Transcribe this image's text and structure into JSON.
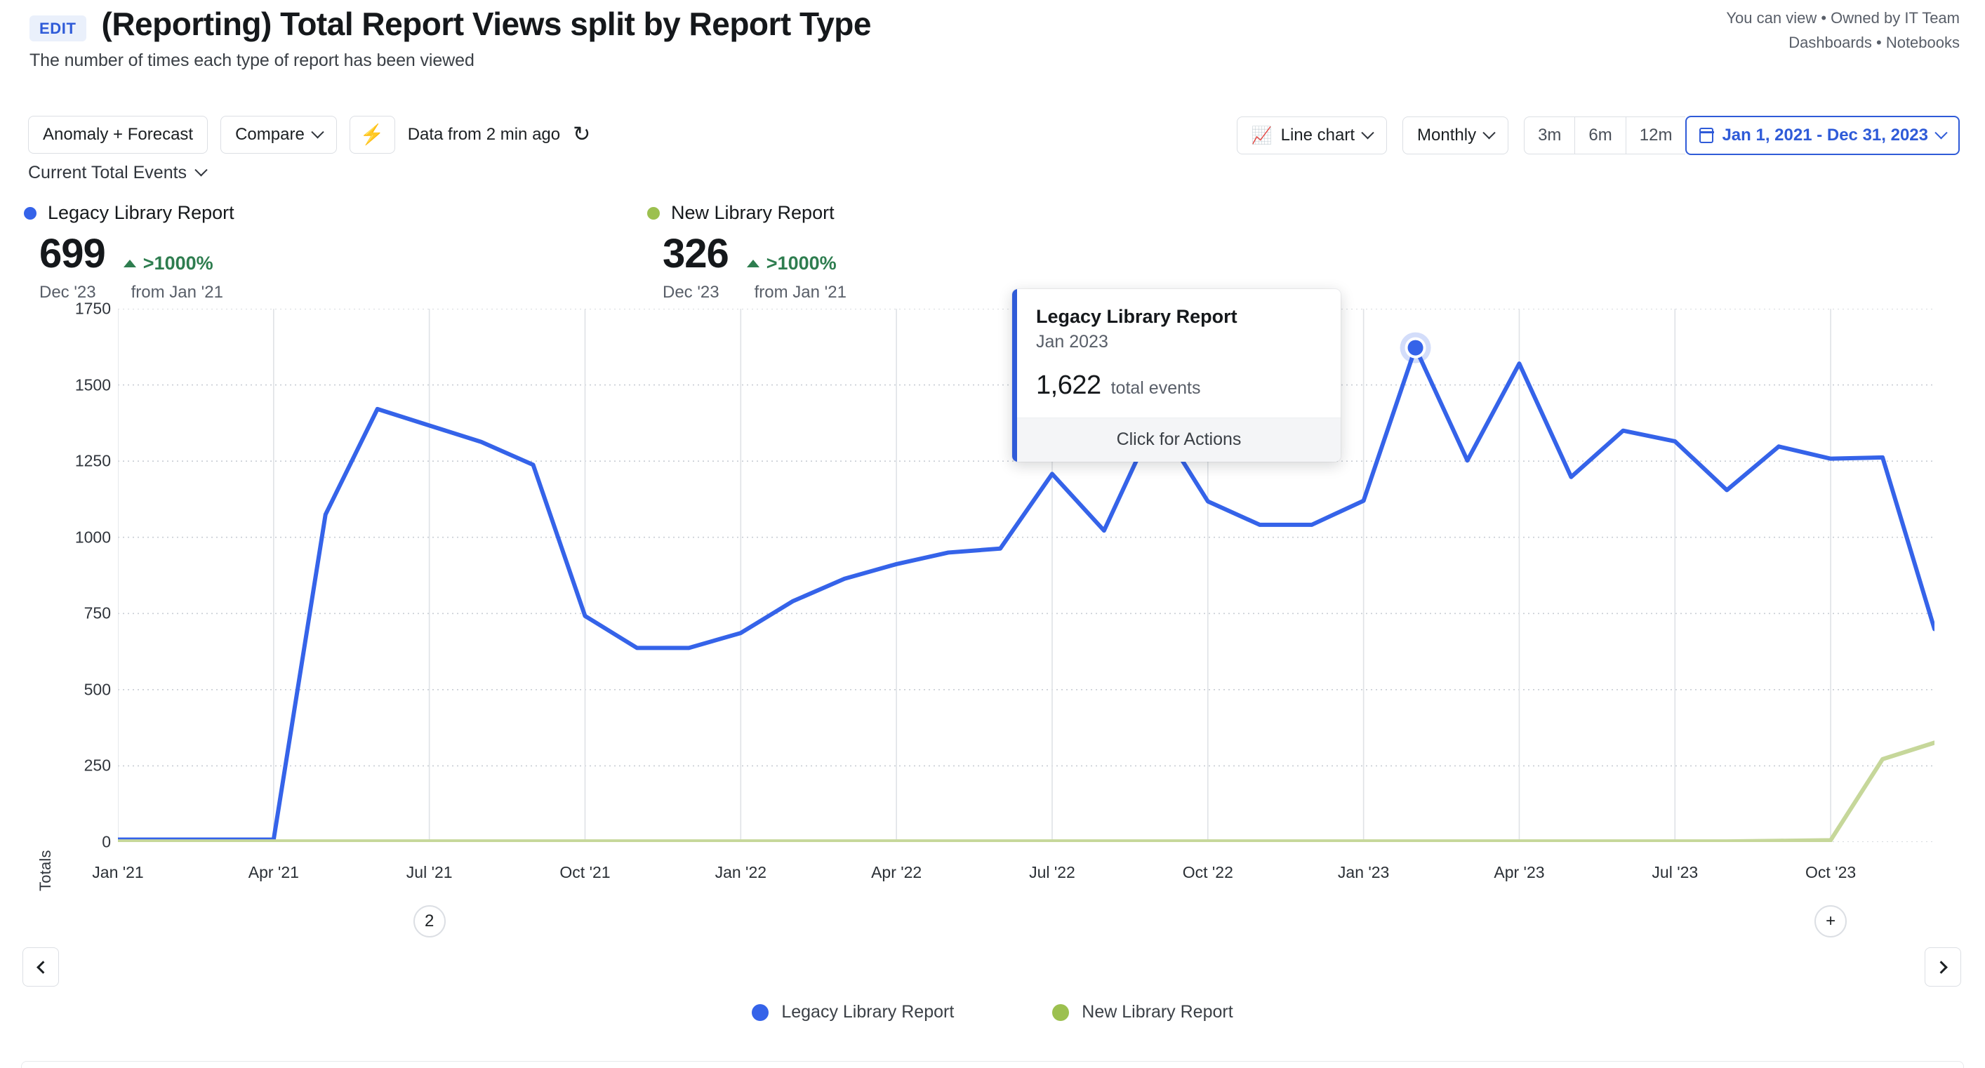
{
  "header": {
    "edit_label": "EDIT",
    "title": "(Reporting) Total Report Views split by Report Type",
    "subtitle": "The number of times each type of report has been viewed",
    "permission_line": "You can view • Owned by IT Team",
    "breadcrumb_line": "Dashboards • Notebooks"
  },
  "toolbar": {
    "anomaly_label": "Anomaly + Forecast",
    "compare_label": "Compare",
    "bolt_icon": "bolt-icon",
    "data_age": "Data from 2 min ago",
    "refresh_icon": "refresh-icon",
    "chart_type_label": "Line chart",
    "granularity_label": "Monthly",
    "range_3m": "3m",
    "range_6m": "6m",
    "range_12m": "12m",
    "date_range": "Jan 1, 2021 - Dec 31, 2023"
  },
  "metric_selector": {
    "label": "Current Total Events"
  },
  "summary_stats": [
    {
      "name": "Legacy Library Report",
      "color": "#3563e9",
      "value": "699",
      "period": "Dec '23",
      "delta": ">1000%",
      "delta_from": "from Jan '21",
      "delta_direction": "up"
    },
    {
      "name": "New Library Report",
      "color": "#9cc04f",
      "value": "326",
      "period": "Dec '23",
      "delta": ">1000%",
      "delta_from": "from Jan '21",
      "delta_direction": "up"
    }
  ],
  "tooltip": {
    "series": "Legacy Library Report",
    "date": "Jan 2023",
    "value": "1,622",
    "unit": "total events",
    "action": "Click for Actions"
  },
  "annotations": [
    {
      "label": "2",
      "x_index": 6
    },
    {
      "label": "+",
      "x_index": 33
    }
  ],
  "nav": {
    "prev_icon": "chevron-left-icon",
    "next_icon": "chevron-right-icon"
  },
  "legend": [
    {
      "label": "Legacy Library Report",
      "color": "#3563e9"
    },
    {
      "label": "New Library Report",
      "color": "#9cc04f"
    }
  ],
  "chart_data": {
    "type": "line",
    "title": "(Reporting) Total Report Views split by Report Type",
    "xlabel": "",
    "ylabel": "Totals",
    "ylim": [
      0,
      1750
    ],
    "yticks": [
      0,
      250,
      500,
      750,
      1000,
      1250,
      1500,
      1750
    ],
    "grid": true,
    "legend_position": "bottom",
    "x": [
      "Jan '21",
      "Feb '21",
      "Mar '21",
      "Apr '21",
      "May '21",
      "Jun '21",
      "Jul '21",
      "Aug '21",
      "Sep '21",
      "Oct '21",
      "Nov '21",
      "Dec '21",
      "Jan '22",
      "Feb '22",
      "Mar '22",
      "Apr '22",
      "May '22",
      "Jun '22",
      "Jul '22",
      "Aug '22",
      "Sep '22",
      "Oct '22",
      "Nov '22",
      "Dec '22",
      "Jan '23",
      "Feb '23",
      "Mar '23",
      "Apr '23",
      "May '23",
      "Jun '23",
      "Jul '23",
      "Aug '23",
      "Sep '23",
      "Oct '23",
      "Nov '23",
      "Dec '23"
    ],
    "xtick_labels": [
      "Jan '21",
      "Apr '21",
      "Jul '21",
      "Oct '21",
      "Jan '22",
      "Apr '22",
      "Jul '22",
      "Oct '22",
      "Jan '23",
      "Apr '23",
      "Jul '23",
      "Oct '23"
    ],
    "xtick_indices": [
      0,
      3,
      6,
      9,
      12,
      15,
      18,
      21,
      24,
      27,
      30,
      33
    ],
    "series": [
      {
        "name": "Legacy Library Report",
        "color": "#3563e9",
        "values": [
          8,
          8,
          8,
          8,
          1075,
          1421,
          1367,
          1313,
          1238,
          742,
          637,
          637,
          686,
          790,
          864,
          912,
          950,
          963,
          1208,
          1022,
          1390,
          1118,
          1041,
          1041,
          1120,
          1622,
          1252,
          1570,
          1198,
          1350,
          1315,
          1155,
          1298,
          1258,
          1262,
          699
        ]
      },
      {
        "name": "New Library Report",
        "color": "#c6d79a",
        "values": [
          2,
          2,
          2,
          2,
          2,
          2,
          2,
          2,
          2,
          2,
          2,
          2,
          2,
          2,
          2,
          2,
          2,
          2,
          2,
          2,
          2,
          2,
          2,
          2,
          2,
          2,
          2,
          2,
          2,
          2,
          2,
          2,
          4,
          6,
          272,
          326
        ]
      }
    ],
    "highlight_point": {
      "series": "Legacy Library Report",
      "x": "Feb '23",
      "x_index": 25,
      "value": 1622
    }
  }
}
